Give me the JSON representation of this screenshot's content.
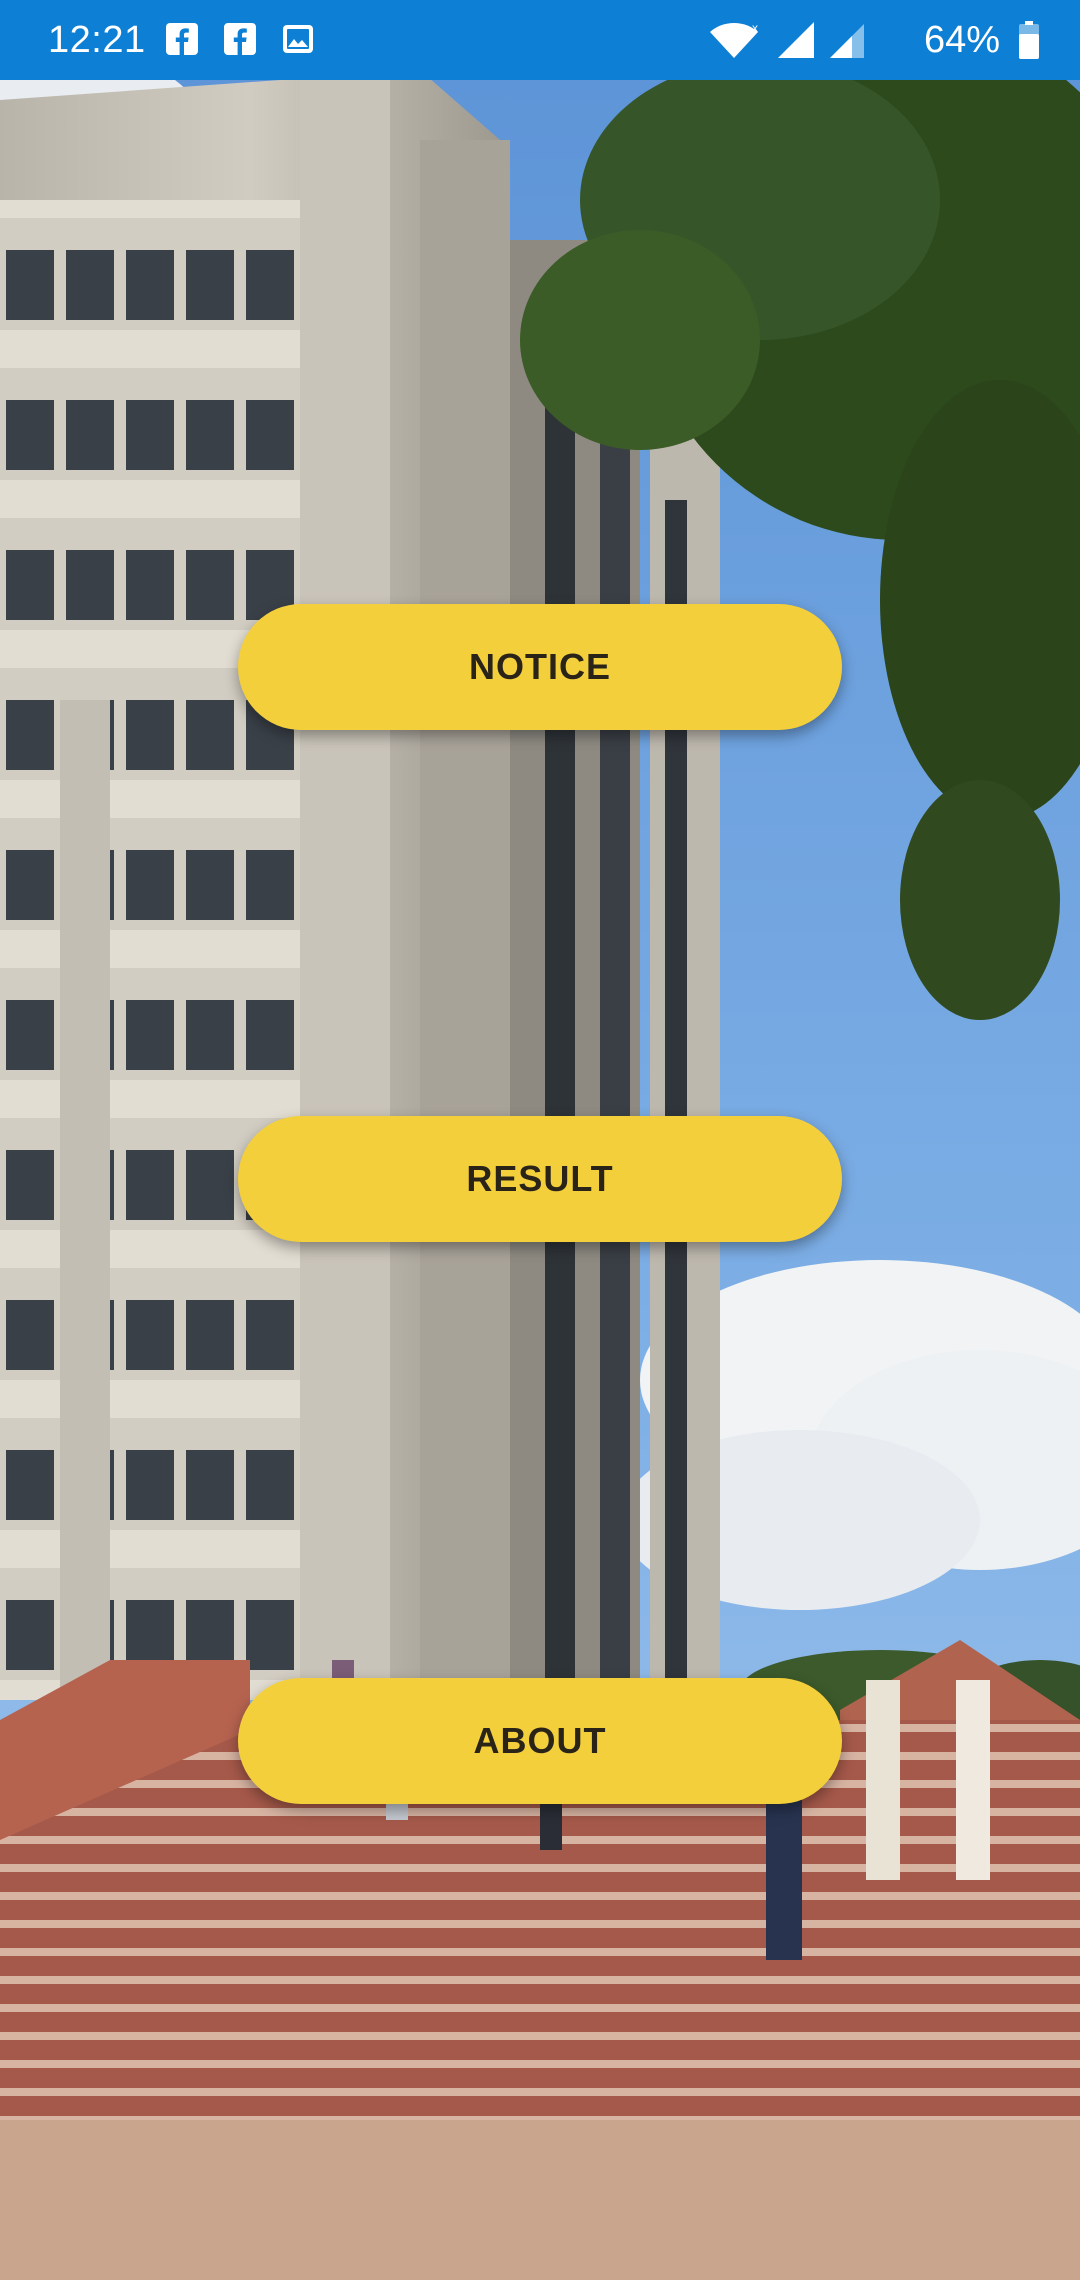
{
  "status_bar": {
    "time": "12:21",
    "battery_percent": "64%",
    "notifications": [
      "facebook-icon",
      "facebook-icon",
      "image-icon"
    ],
    "icons": [
      "wifi-icon",
      "cell-signal-icon",
      "cell-signal-icon",
      "battery-icon"
    ],
    "background_color": "#0d7fd4"
  },
  "menu": {
    "notice_label": "NOTICE",
    "result_label": "RESULT",
    "about_label": "ABOUT",
    "button_color": "#f4cf3c",
    "text_color": "#2a2418"
  },
  "background": {
    "image": "campus-building-photo"
  }
}
